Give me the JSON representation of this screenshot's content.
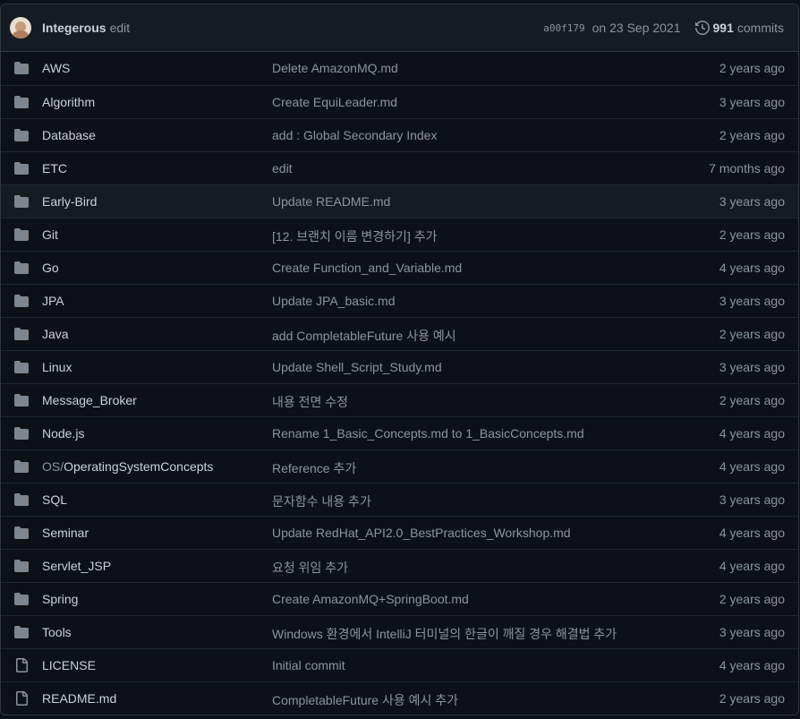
{
  "header": {
    "author": "Integerous",
    "commit_message": "edit",
    "sha": "a00f179",
    "date": "on 23 Sep 2021",
    "commit_count": "991",
    "commits_label": "commits"
  },
  "colors": {
    "folder": "#7d8590",
    "file": "#8b949e",
    "background": "#0d1117",
    "header_background": "#161b22",
    "border": "#30363d"
  },
  "files": [
    {
      "type": "folder-icon",
      "name": "AWS",
      "message": "Delete AmazonMQ.md",
      "age": "2 years ago"
    },
    {
      "type": "folder-icon",
      "name": "Algorithm",
      "message": "Create EquiLeader.md",
      "age": "3 years ago"
    },
    {
      "type": "folder-icon",
      "name": "Database",
      "message": "add : Global Secondary Index",
      "age": "2 years ago"
    },
    {
      "type": "folder-icon",
      "name": "ETC",
      "message": "edit",
      "age": "7 months ago"
    },
    {
      "type": "folder-icon",
      "name": "Early-Bird",
      "message": "Update README.md",
      "age": "3 years ago"
    },
    {
      "type": "folder-icon",
      "name": "Git",
      "message": "[12. 브랜치 이름 변경하기] 추가",
      "age": "2 years ago"
    },
    {
      "type": "folder-icon",
      "name": "Go",
      "message": "Create Function_and_Variable.md",
      "age": "4 years ago"
    },
    {
      "type": "folder-icon",
      "name": "JPA",
      "message": "Update JPA_basic.md",
      "age": "3 years ago"
    },
    {
      "type": "folder-icon",
      "name": "Java",
      "message": "add CompletableFuture 사용 예시",
      "age": "2 years ago"
    },
    {
      "type": "folder-icon",
      "name": "Linux",
      "message": "Update Shell_Script_Study.md",
      "age": "3 years ago"
    },
    {
      "type": "folder-icon",
      "name": "Message_Broker",
      "message": "내용 전면 수정",
      "age": "2 years ago"
    },
    {
      "type": "folder-icon",
      "name": "Node.js",
      "message": "Rename 1_Basic_Concepts.md to 1_BasicConcepts.md",
      "age": "4 years ago"
    },
    {
      "type": "folder-icon",
      "dir": "OS/",
      "name": "OperatingSystemConcepts",
      "message": "Reference 추가",
      "age": "4 years ago"
    },
    {
      "type": "folder-icon",
      "name": "SQL",
      "message": "문자함수 내용 추가",
      "age": "3 years ago"
    },
    {
      "type": "folder-icon",
      "name": "Seminar",
      "message": "Update RedHat_API2.0_BestPractices_Workshop.md",
      "age": "4 years ago"
    },
    {
      "type": "folder-icon",
      "name": "Servlet_JSP",
      "message": "요청 위임 추가",
      "age": "4 years ago"
    },
    {
      "type": "folder-icon",
      "name": "Spring",
      "message": "Create AmazonMQ+SpringBoot.md",
      "age": "2 years ago"
    },
    {
      "type": "folder-icon",
      "name": "Tools",
      "message": "Windows 환경에서 IntelliJ 터미널의 한글이 깨질 경우 해결법 추가",
      "age": "3 years ago"
    },
    {
      "type": "file-icon",
      "name": "LICENSE",
      "message": "Initial commit",
      "age": "4 years ago"
    },
    {
      "type": "file-icon",
      "name": "README.md",
      "message": "CompletableFuture 사용 예시 추가",
      "age": "2 years ago"
    }
  ]
}
